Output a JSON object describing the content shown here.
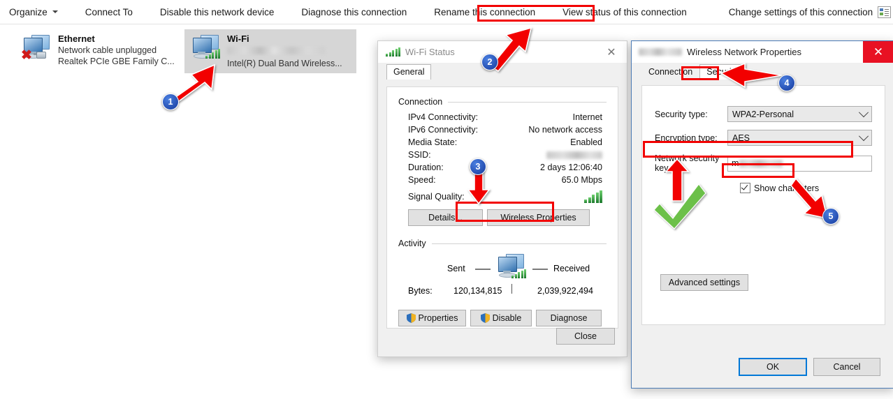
{
  "toolbar": {
    "items": [
      {
        "label": "Organize",
        "caret": true
      },
      {
        "label": "Connect To",
        "caret": false
      },
      {
        "label": "Disable this network device",
        "caret": false
      },
      {
        "label": "Diagnose this connection",
        "caret": false
      },
      {
        "label": "Rename this connection",
        "caret": false
      },
      {
        "label": "View status of this connection",
        "caret": false,
        "highlighted": true
      },
      {
        "label": "Change settings of this connection",
        "caret": false
      }
    ],
    "view_icon": "view-layout-icon",
    "dropdown_icon": "chevron-down-icon",
    "help_icon": "help-icon"
  },
  "adapters": [
    {
      "name": "Ethernet",
      "status": "Network cable unplugged",
      "device": "Realtek PCIe GBE Family C...",
      "selected": false,
      "icon": "network-monitor-icon",
      "overlay_icon": "red-x-icon"
    },
    {
      "name": "Wi-Fi",
      "status_redacted": true,
      "device": "Intel(R) Dual Band Wireless...",
      "selected": true,
      "icon": "network-monitor-icon",
      "overlay_icon": "wifi-signal-icon"
    }
  ],
  "wifi_status": {
    "title": "Wi-Fi Status",
    "title_icon": "wifi-signal-icon",
    "close_icon": "close-icon",
    "tabs": [
      {
        "label": "General",
        "active": true
      }
    ],
    "connection_group": "Connection",
    "connection_rows": [
      {
        "key": "IPv4 Connectivity:",
        "value": "Internet"
      },
      {
        "key": "IPv6 Connectivity:",
        "value": "No network access"
      },
      {
        "key": "Media State:",
        "value": "Enabled"
      },
      {
        "key": "SSID:",
        "value": "",
        "redacted": true
      },
      {
        "key": "Duration:",
        "value": "2 days 12:06:40"
      },
      {
        "key": "Speed:",
        "value": "65.0 Mbps"
      },
      {
        "key": "Signal Quality:",
        "value": "",
        "icon": "signal-bars-icon"
      }
    ],
    "details_button": "Details...",
    "wireless_properties_button": "Wireless Properties",
    "activity_group": "Activity",
    "activity_sent_label": "Sent",
    "activity_received_label": "Received",
    "activity_icon": "network-transfer-icon",
    "bytes_label": "Bytes:",
    "bytes_sent": "120,134,815",
    "bytes_received": "2,039,922,494",
    "properties_button": "Properties",
    "disable_button": "Disable",
    "diagnose_button": "Diagnose",
    "close_button": "Close",
    "shield_icon": "uac-shield-icon"
  },
  "wireless_properties": {
    "title": "Wireless Network Properties",
    "title_prefix_redacted": true,
    "close_icon": "close-icon",
    "tabs": [
      {
        "label": "Connection",
        "active": false
      },
      {
        "label": "Security",
        "active": true
      }
    ],
    "security_type_label": "Security type:",
    "security_type_value": "WPA2-Personal",
    "encryption_type_label": "Encryption type:",
    "encryption_type_value": "AES",
    "network_key_label": "Network security key",
    "network_key_value": "m",
    "network_key_redacted": true,
    "show_characters_label": "Show characters",
    "show_characters_checked": true,
    "advanced_settings_button": "Advanced settings",
    "ok_button": "OK",
    "cancel_button": "Cancel",
    "chevron_icon": "chevron-down-icon"
  },
  "annotations": {
    "steps": [
      "1",
      "2",
      "3",
      "4",
      "5"
    ],
    "arrow_color": "#f20000",
    "highlight_color": "#f20000",
    "badge_color": "#15399c",
    "check_color": "#6cc04a",
    "check_icon": "green-check-icon"
  }
}
